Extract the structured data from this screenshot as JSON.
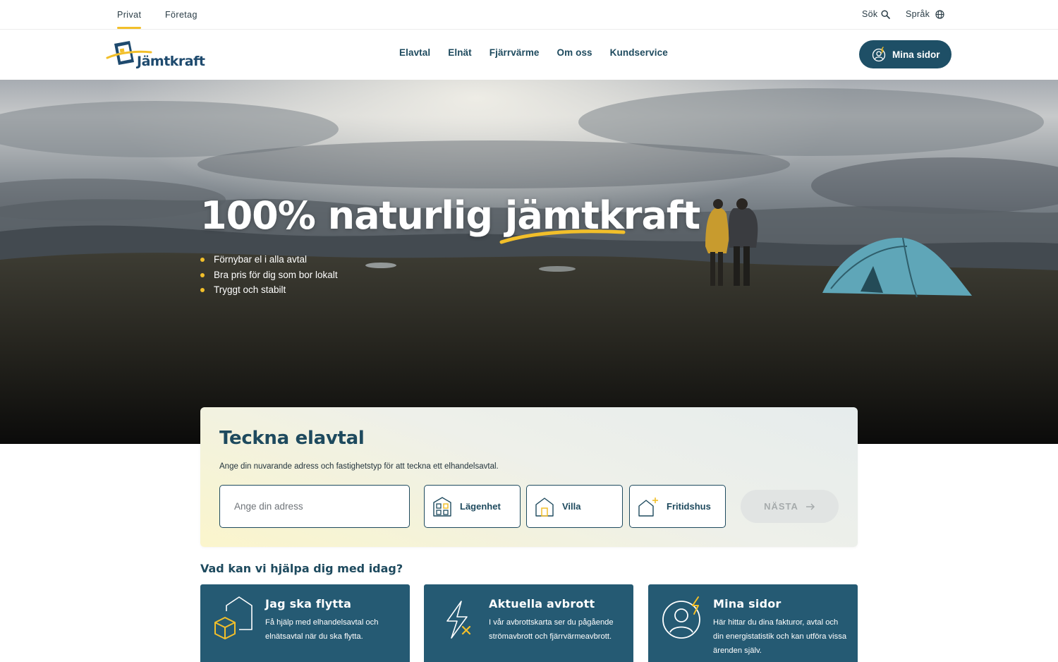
{
  "topbar": {
    "segments": [
      {
        "label": "Privat",
        "active": true
      },
      {
        "label": "Företag",
        "active": false
      }
    ],
    "search_label": "Sök",
    "language_label": "Språk"
  },
  "header": {
    "logo_text": "Jämtkraft",
    "nav": [
      "Elavtal",
      "Elnät",
      "Fjärrvärme",
      "Om oss",
      "Kundservice"
    ],
    "mina_sidor_label": "Mina sidor"
  },
  "hero": {
    "title": "100% naturlig jämtkraft",
    "bullets": [
      "Förnybar el i alla avtal",
      "Bra pris för dig som bor lokalt",
      "Tryggt och stabilt"
    ]
  },
  "form": {
    "title": "Teckna elavtal",
    "subtitle": "Ange din nuvarande adress och fastighetstyp för att teckna ett elhandelsavtal.",
    "address_placeholder": "Ange din adress",
    "options": [
      "Lägenhet",
      "Villa",
      "Fritidshus"
    ],
    "next_label": "NÄSTA"
  },
  "help": {
    "title": "Vad kan vi hjälpa dig med idag?",
    "cards": [
      {
        "title": "Jag ska flytta",
        "text": "Få hjälp med elhandelsavtal och elnätsavtal när du ska flytta.",
        "icon": "moving-house-icon"
      },
      {
        "title": "Aktuella avbrott",
        "text": "I vår avbrottskarta ser du pågående strömavbrott och fjärrvärmeavbrott.",
        "icon": "power-outage-icon"
      },
      {
        "title": "Mina sidor",
        "text": "Här hittar du dina fakturor, avtal och din energistatistik och kan utföra vissa ärenden själv.",
        "icon": "user-energy-icon"
      }
    ]
  },
  "colors": {
    "primary": "#1e4a5e",
    "button": "#1e4f66",
    "accent": "#f2bf2a",
    "card": "#255a73"
  }
}
